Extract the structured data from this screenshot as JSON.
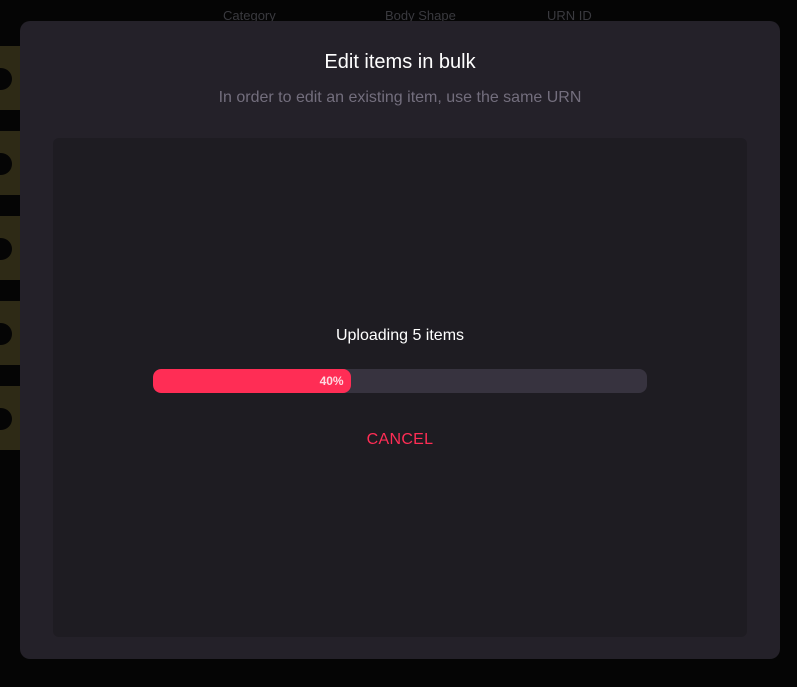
{
  "background": {
    "table_headers": [
      "Category",
      "Body Shape",
      "URN ID"
    ]
  },
  "modal": {
    "title": "Edit items in bulk",
    "subtitle": "In order to edit an existing item, use the same URN",
    "upload": {
      "label": "Uploading 5 items",
      "progress_fraction": 0.4,
      "progress_text": "40%",
      "cancel_label": "CANCEL"
    }
  },
  "colors": {
    "accent": "#ff2d55",
    "modal_bg": "#242129",
    "panel_bg": "#1e1c22",
    "track_bg": "#37333f"
  }
}
